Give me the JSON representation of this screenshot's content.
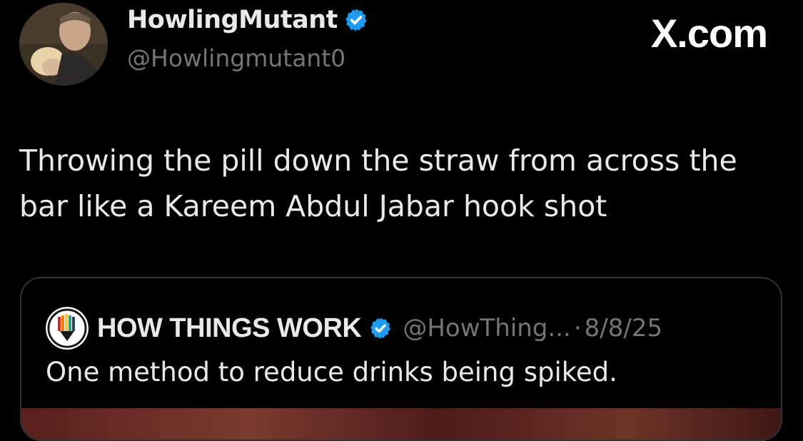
{
  "author": {
    "display_name": "HowlingMutant",
    "handle": "@Howlingmutant0",
    "verified": true,
    "avatar_icon": "profile-photo"
  },
  "site_label": "X.com",
  "tweet": {
    "text": "Throwing the pill down the straw from across the bar like a Kareem Abdul Jabar hook shot"
  },
  "quote": {
    "display_name": "HOW THINGS WORK",
    "handle": "@HowThing...",
    "separator": "·",
    "date": "8/8/25",
    "verified": true,
    "text": "One method to reduce drinks being spiked.",
    "avatar_icon": "how-things-work-logo"
  },
  "colors": {
    "background": "#000000",
    "primary_text": "#e7e9ea",
    "secondary_text": "#71767b",
    "verified_blue": "#1d9bf0",
    "card_border": "#2f3336"
  }
}
